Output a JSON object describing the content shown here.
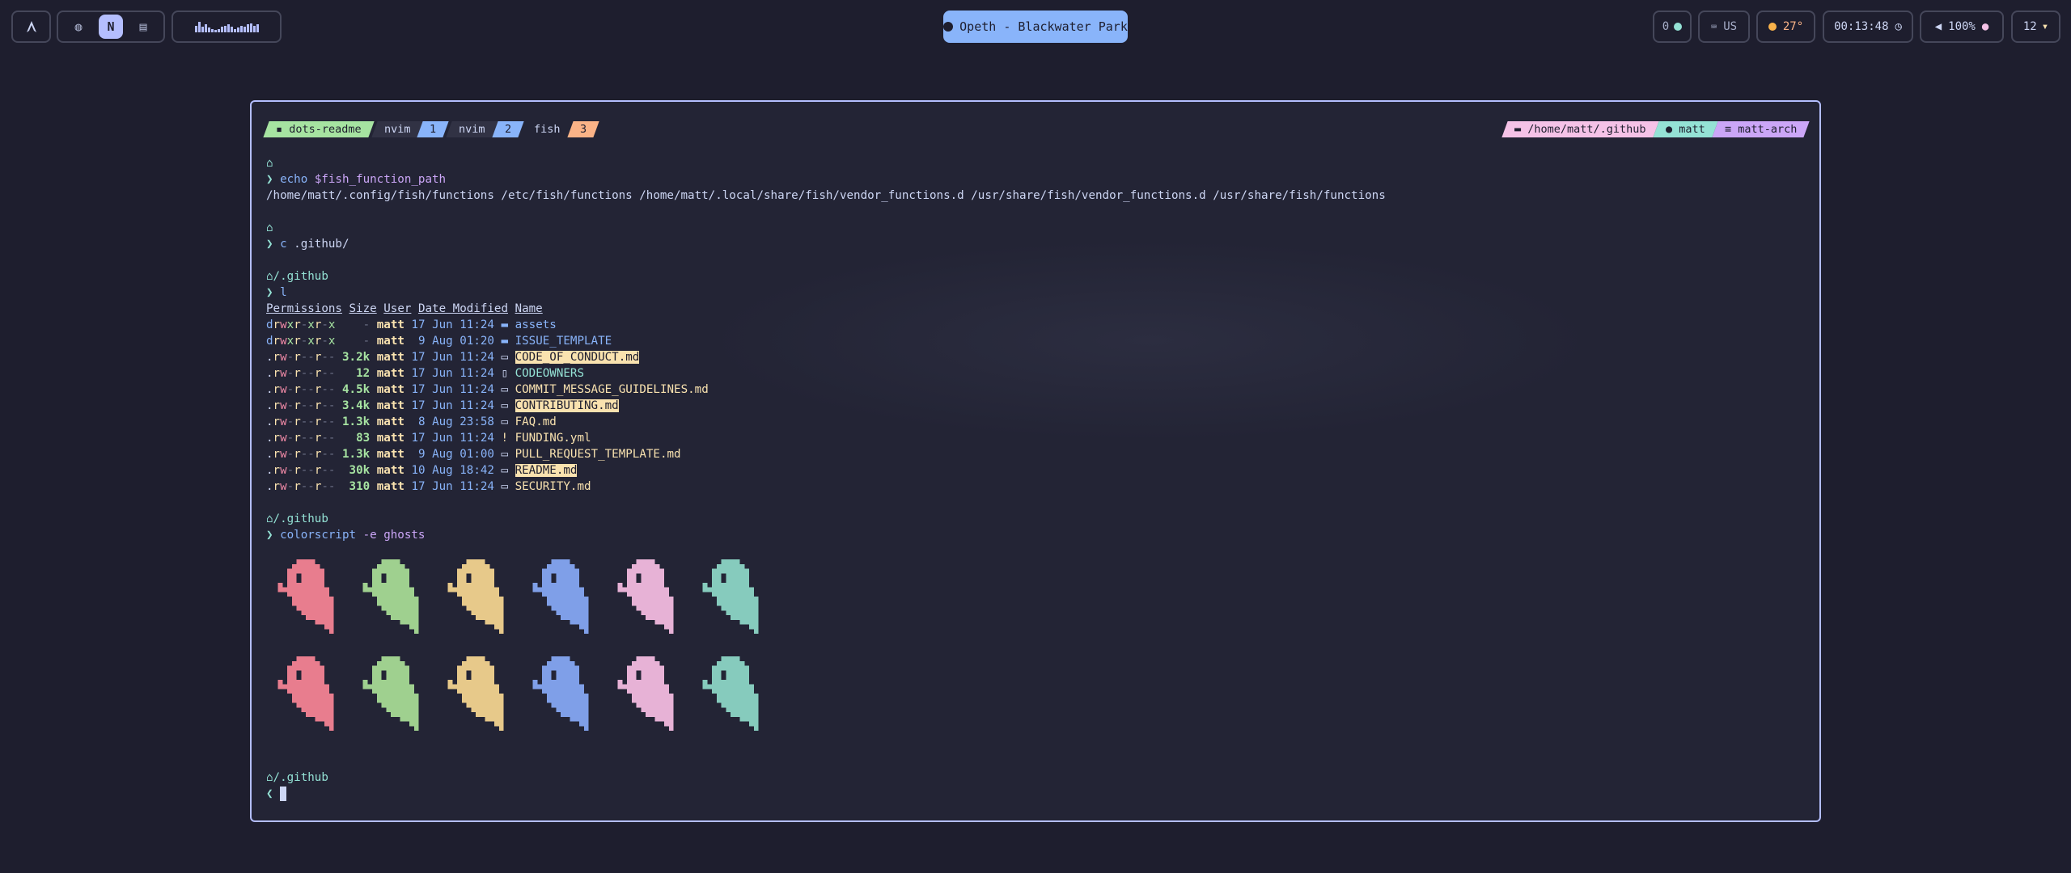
{
  "topbar": {
    "workspaces": [
      {
        "glyph": "◍",
        "active": false
      },
      {
        "glyph": "N",
        "active": true
      },
      {
        "glyph": "▤",
        "active": false
      }
    ],
    "media": {
      "title": "Opeth - Blackwater Park"
    },
    "updates": {
      "count": "0"
    },
    "keyboard": {
      "layout": "US"
    },
    "weather": {
      "temp": "27°"
    },
    "clock": {
      "time": "00:13:48"
    },
    "volume": {
      "level": "100%"
    },
    "notifications": {
      "count": "12"
    },
    "visualizer_levels": [
      0.6,
      0.9,
      0.5,
      0.7,
      0.4,
      0.3,
      0.2,
      0.3,
      0.5,
      0.6,
      0.7,
      0.5,
      0.3,
      0.4,
      0.6,
      0.5,
      0.7,
      0.8,
      0.6,
      0.7
    ]
  },
  "terminal": {
    "tabs": [
      {
        "label": "dots-readme",
        "icon": "terminal-icon"
      },
      {
        "label": "nvim"
      },
      {
        "label": "1"
      },
      {
        "label": "nvim"
      },
      {
        "label": "2"
      },
      {
        "label": "fish"
      },
      {
        "label": "3"
      }
    ],
    "right": {
      "path": "/home/matt/.github",
      "user": "matt",
      "host": "matt-arch"
    },
    "prompt_char": "❯",
    "home_glyph": "⌂",
    "blocks": [
      {
        "cwd": "",
        "cmd": "echo",
        "args": " $fish_function_path",
        "output": "/home/matt/.config/fish/functions /etc/fish/functions /home/matt/.local/share/fish/vendor_functions.d /usr/share/fish/vendor_functions.d /usr/share/fish/functions"
      },
      {
        "cwd": "",
        "cmd": "c",
        "args": " .github/"
      },
      {
        "cwd": "/.github",
        "cmd": "l",
        "args": ""
      },
      {
        "cwd": "/.github",
        "cmd": "colorscript",
        "args": " -e ghosts"
      },
      {
        "cwd": "/.github"
      }
    ],
    "listing": {
      "headers": [
        "Permissions",
        "Size",
        "User",
        "Date Modified",
        "Name"
      ],
      "rows": [
        {
          "perm": "drwxr-xr-x",
          "size": "-",
          "user": "matt",
          "date": "17 Jun 11:24",
          "name": "assets",
          "icon": "folder-icon",
          "kind": "dir",
          "hl": false
        },
        {
          "perm": "drwxr-xr-x",
          "size": "-",
          "user": "matt",
          "date": " 9 Aug 01:20",
          "name": "ISSUE_TEMPLATE",
          "icon": "folder-icon",
          "kind": "dir",
          "hl": false
        },
        {
          "perm": ".rw-r--r--",
          "size": "3.2k",
          "user": "matt",
          "date": "17 Jun 11:24",
          "name": "CODE_OF_CONDUCT.md",
          "icon": "markdown-icon",
          "kind": "md",
          "hl": true
        },
        {
          "perm": ".rw-r--r--",
          "size": "12",
          "user": "matt",
          "date": "17 Jun 11:24",
          "name": "CODEOWNERS",
          "icon": "file-icon",
          "kind": "file",
          "hl": false
        },
        {
          "perm": ".rw-r--r--",
          "size": "4.5k",
          "user": "matt",
          "date": "17 Jun 11:24",
          "name": "COMMIT_MESSAGE_GUIDELINES.md",
          "icon": "markdown-icon",
          "kind": "md",
          "hl": false
        },
        {
          "perm": ".rw-r--r--",
          "size": "3.4k",
          "user": "matt",
          "date": "17 Jun 11:24",
          "name": "CONTRIBUTING.md",
          "icon": "markdown-icon",
          "kind": "md",
          "hl": true
        },
        {
          "perm": ".rw-r--r--",
          "size": "1.3k",
          "user": "matt",
          "date": " 8 Aug 23:58",
          "name": "FAQ.md",
          "icon": "markdown-icon",
          "kind": "md",
          "hl": false
        },
        {
          "perm": ".rw-r--r--",
          "size": "83",
          "user": "matt",
          "date": "17 Jun 11:24",
          "name": "FUNDING.yml",
          "icon": "yaml-icon",
          "kind": "yml",
          "hl": false
        },
        {
          "perm": ".rw-r--r--",
          "size": "1.3k",
          "user": "matt",
          "date": " 9 Aug 01:00",
          "name": "PULL_REQUEST_TEMPLATE.md",
          "icon": "markdown-icon",
          "kind": "md",
          "hl": false
        },
        {
          "perm": ".rw-r--r--",
          "size": "30k",
          "user": "matt",
          "date": "10 Aug 18:42",
          "name": "README.md",
          "icon": "markdown-icon",
          "kind": "md",
          "hl": true
        },
        {
          "perm": ".rw-r--r--",
          "size": "310",
          "user": "matt",
          "date": "17 Jun 11:24",
          "name": "SECURITY.md",
          "icon": "markdown-icon",
          "kind": "md",
          "hl": false
        }
      ]
    },
    "ghost_colors": [
      "#e87d8e",
      "#9fd08f",
      "#e7c98a",
      "#7f9fe8",
      "#e7b2d6",
      "#86cbbd"
    ],
    "colors": {
      "border": "#b4befe",
      "blue": "#89b4fa",
      "green": "#a6e3a1",
      "yellow": "#f9e2af",
      "peach": "#fab387",
      "pink": "#f5c2e7",
      "teal": "#94e2d5",
      "mauve": "#cba6f7"
    }
  }
}
